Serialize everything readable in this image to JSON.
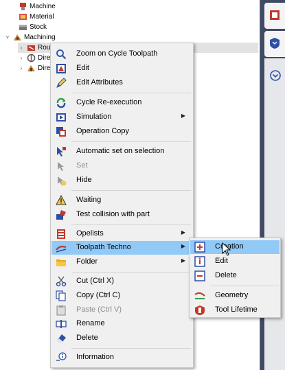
{
  "tree": {
    "items": [
      {
        "label": "Machine",
        "expander": ""
      },
      {
        "label": "Material",
        "expander": ""
      },
      {
        "label": "Stock",
        "expander": ""
      },
      {
        "label": "Machining",
        "expander": "˅"
      },
      {
        "label": "Rou",
        "expander": "›"
      },
      {
        "label": "Dire",
        "expander": "›"
      },
      {
        "label": "Dire",
        "expander": "›"
      }
    ]
  },
  "context_menu": {
    "items": [
      {
        "label": "Zoom on Cycle Toolpath",
        "icon": "zoom-icon"
      },
      {
        "label": "Edit",
        "icon": "edit-icon"
      },
      {
        "label": "Edit Attributes",
        "icon": "edit-attributes-icon"
      },
      {
        "label": "Cycle Re-execution",
        "icon": "re-execution-icon"
      },
      {
        "label": "Simulation",
        "icon": "simulation-icon",
        "arrow": "▶"
      },
      {
        "label": "Operation Copy",
        "icon": "operation-copy-icon"
      },
      {
        "label": "Automatic set on selection",
        "icon": "automatic-set-icon"
      },
      {
        "label": "Set",
        "icon": "set-icon",
        "disabled": true
      },
      {
        "label": "Hide",
        "icon": "hide-icon"
      },
      {
        "label": "Waiting",
        "icon": "waiting-icon"
      },
      {
        "label": "Test collision with part",
        "icon": "collision-icon"
      },
      {
        "label": "Opelists",
        "icon": "opelists-icon",
        "arrow": "▶"
      },
      {
        "label": "Toolpath Techno",
        "icon": "toolpath-techno-icon",
        "arrow": "▶",
        "highlighted": true
      },
      {
        "label": "Folder",
        "icon": "folder-icon",
        "arrow": "▶"
      },
      {
        "label": "Cut (Ctrl X)",
        "icon": "cut-icon"
      },
      {
        "label": "Copy (Ctrl C)",
        "icon": "copy-icon"
      },
      {
        "label": "Paste (Ctrl V)",
        "icon": "paste-icon",
        "disabled": true
      },
      {
        "label": "Rename",
        "icon": "rename-icon"
      },
      {
        "label": "Delete",
        "icon": "delete-icon"
      },
      {
        "label": "Information",
        "icon": "information-icon"
      }
    ]
  },
  "submenu": {
    "items": [
      {
        "label": "Creation",
        "icon": "creation-icon",
        "highlighted": true
      },
      {
        "label": "Edit",
        "icon": "edit-techno-icon"
      },
      {
        "label": "Delete",
        "icon": "delete-techno-icon"
      },
      {
        "label": "Geometry",
        "icon": "geometry-icon"
      },
      {
        "label": "Tool Lifetime",
        "icon": "tool-lifetime-icon"
      }
    ]
  },
  "colors": {
    "menu_background": "#f0f0f0",
    "highlight": "#91c9f7",
    "panel_dark": "#3f4a63",
    "disabled_text": "#8d8d8d"
  }
}
